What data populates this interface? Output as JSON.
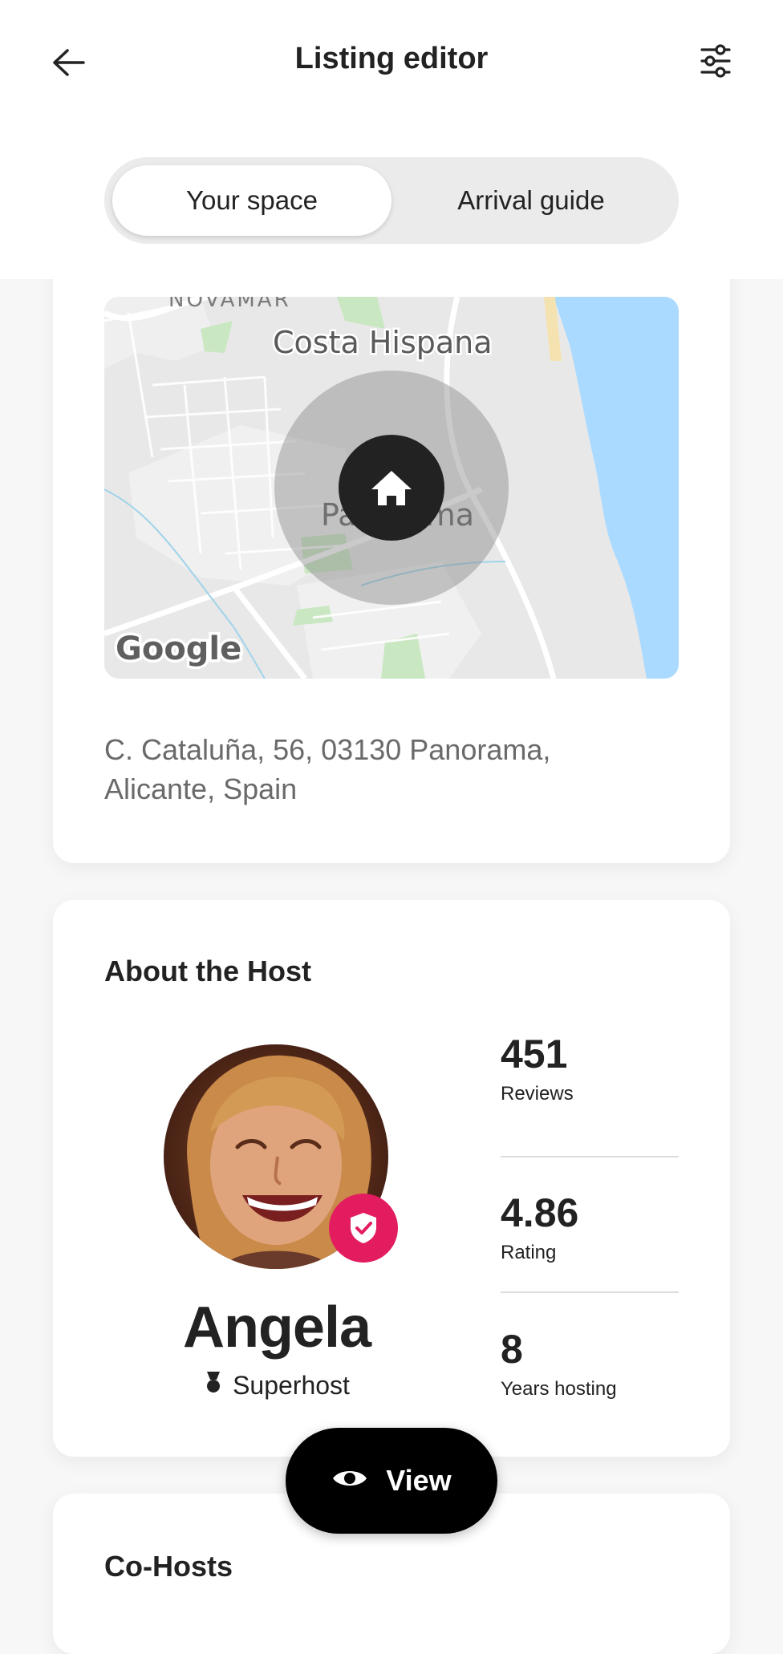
{
  "header": {
    "title": "Listing editor",
    "back_icon": "arrow-left-icon",
    "settings_icon": "sliders-icon"
  },
  "tabs": {
    "active": "Your space",
    "inactive": "Arrival guide"
  },
  "map": {
    "labels": {
      "top": "NOVAMAR",
      "area": "Costa Hispana",
      "town": "Panorama"
    },
    "logo": "Google",
    "marker_icon": "home-icon"
  },
  "address": {
    "line1": "C. Cataluña, 56, 03130 Panorama,",
    "line2": "Alicante, Spain"
  },
  "host": {
    "section_title": "About the Host",
    "name": "Angela",
    "badge": "Superhost",
    "stats": [
      {
        "value": "451",
        "label": "Reviews"
      },
      {
        "value": "4.86",
        "label": "Rating"
      },
      {
        "value": "8",
        "label": "Years hosting"
      }
    ]
  },
  "cohosts": {
    "section_title": "Co-Hosts"
  },
  "fab": {
    "label": "View",
    "icon": "eye-icon"
  },
  "colors": {
    "superhost_badge": "#e31c5f",
    "text": "#222222",
    "muted_text": "#6a6a6a",
    "button_bg": "#000000"
  }
}
